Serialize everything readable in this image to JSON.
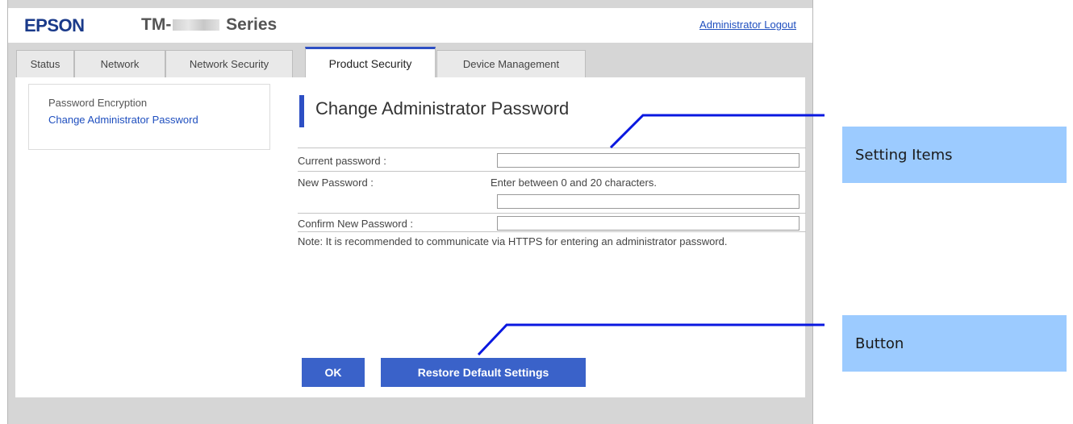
{
  "header": {
    "brand": "EPSON",
    "model_prefix": "TM-",
    "model_suffix": "Series",
    "logout": "Administrator Logout"
  },
  "tabs": [
    {
      "label": "Status"
    },
    {
      "label": "Network"
    },
    {
      "label": "Network Security"
    },
    {
      "label": "Product Security",
      "active": true
    },
    {
      "label": "Device Management"
    }
  ],
  "sidebar": {
    "items": [
      {
        "label": "Password Encryption"
      },
      {
        "label": "Change Administrator Password"
      }
    ]
  },
  "main": {
    "title": "Change Administrator Password",
    "current_password_label": "Current password :",
    "new_password_label": "New Password :",
    "new_password_hint": "Enter between 0 and 20 characters.",
    "confirm_password_label": "Confirm New Password :",
    "note": "Note: It is recommended to communicate via HTTPS for entering an administrator password.",
    "current_password_value": "",
    "new_password_value": "",
    "confirm_password_value": ""
  },
  "buttons": {
    "ok": "OK",
    "restore": "Restore Default Settings"
  },
  "callouts": {
    "setting_items": "Setting Items",
    "button": "Button"
  },
  "colors": {
    "accent": "#2d4fc4",
    "button": "#3a62c9",
    "callout": "#9ccbff",
    "link": "#1f4fbf"
  }
}
